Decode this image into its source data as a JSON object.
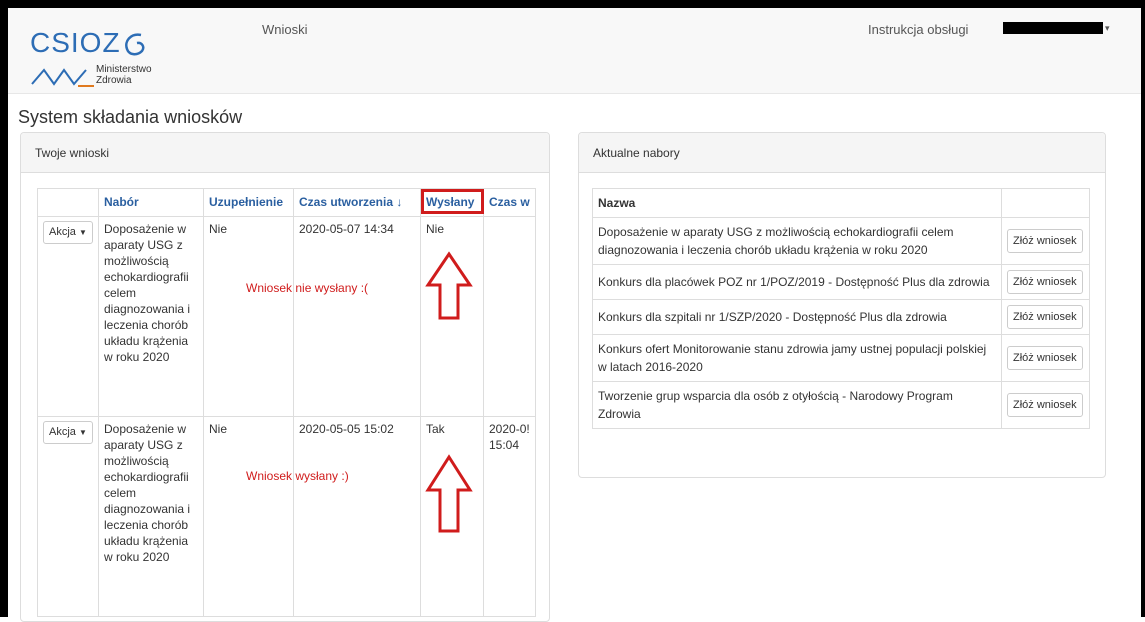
{
  "navbar": {
    "logo_text": "CSIOZ",
    "logo_ministry_line1": "Ministerstwo",
    "logo_ministry_line2": "Zdrowia",
    "nav_wnioski": "Wnioski",
    "nav_instrukcja": "Instrukcja obsługi"
  },
  "page_title": "System składania wniosków",
  "left_panel": {
    "heading": "Twoje wnioski",
    "columns": [
      "",
      "Nabór",
      "Uzupełnienie",
      "Czas utworzenia ↓",
      "Wysłany",
      "Czas w"
    ],
    "rows": [
      {
        "action": "Akcja",
        "nabor": "Doposażenie w aparaty USG z możliwością echokardiografii celem diagnozowania i leczenia chorób układu krążenia w roku 2020",
        "uzupelnienie": "Nie",
        "czas_utworzenia": "2020-05-07 14:34",
        "wyslany": "Nie",
        "czas_wyslania": ""
      },
      {
        "action": "Akcja",
        "nabor": "Doposażenie w aparaty USG z możliwością echokardiografii celem diagnozowania i leczenia chorób układu krążenia w roku 2020",
        "uzupelnienie": "Nie",
        "czas_utworzenia": "2020-05-05 15:02",
        "wyslany": "Tak",
        "czas_wyslania": "2020-0! 15:04"
      }
    ],
    "annotations": {
      "note_not_sent": "Wniosek nie wysłany :(",
      "note_sent": "Wniosek wysłany :)"
    }
  },
  "right_panel": {
    "heading": "Aktualne nabory",
    "column_name": "Nazwa",
    "rows": [
      {
        "name": "Doposażenie w aparaty USG z możliwością echokardiografii celem diagnozowania i leczenia chorób układu krążenia w roku 2020",
        "button": "Złóż wniosek"
      },
      {
        "name": "Konkurs dla placówek POZ nr 1/POZ/2019 - Dostępność Plus dla zdrowia",
        "button": "Złóż wniosek"
      },
      {
        "name": "Konkurs dla szpitali nr 1/SZP/2020 - Dostępność Plus dla zdrowia",
        "button": "Złóż wniosek"
      },
      {
        "name": "Konkurs ofert Monitorowanie stanu zdrowia jamy ustnej populacji polskiej w latach 2016-2020",
        "button": "Złóż wniosek"
      },
      {
        "name": "Tworzenie grup wsparcia dla osób z otyłością - Narodowy Program Zdrowia",
        "button": "Złóż wniosek"
      }
    ]
  },
  "colors": {
    "accent_blue": "#2a5fa0",
    "annotation_red": "#d01c1c",
    "logo_blue": "#2d6db5"
  }
}
